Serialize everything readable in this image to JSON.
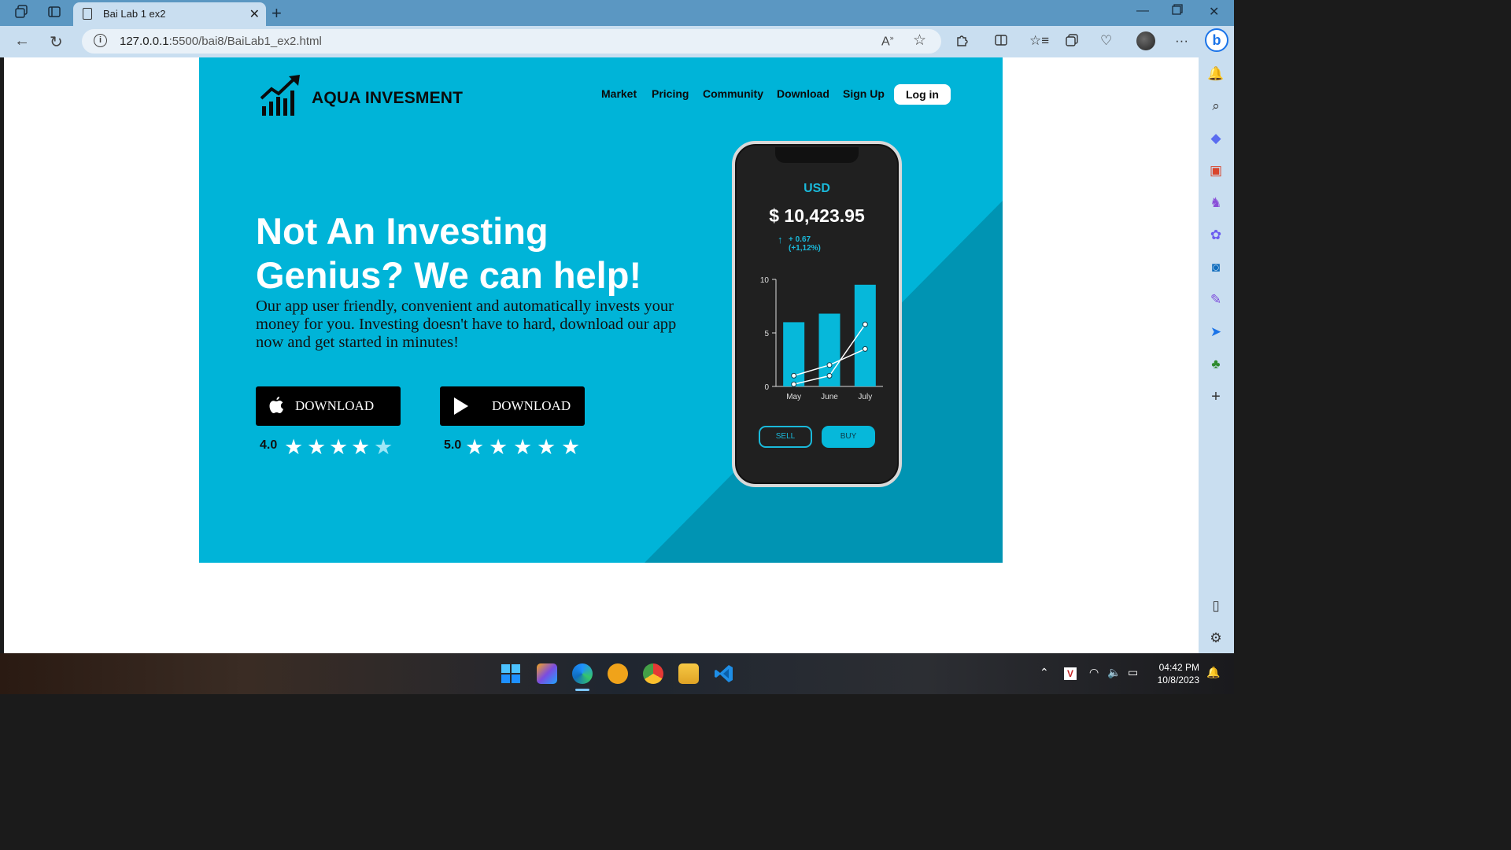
{
  "browser": {
    "tab_title": "Bai Lab 1 ex2",
    "url_host": "127.0.0.1",
    "url_path": ":5500/bai8/BaiLab1_ex2.html"
  },
  "site": {
    "brand": "AQUA INVESMENT",
    "nav": [
      "Market",
      "Pricing",
      "Community",
      "Download",
      "Sign Up"
    ],
    "login": "Log in",
    "headline_line1": "Not An Investing",
    "headline_line2": "Genius? We can help!",
    "description": "Our app user friendly, convenient and automatically invests your money for you. Investing doesn't have to hard, download our app now and get started in minutes!",
    "apple_button": "DOWNLOAD",
    "play_button": "DOWNLOAD",
    "apple_rating": "4.0",
    "play_rating": "5.0",
    "apple_stars": 4.5,
    "play_stars": 5
  },
  "phone": {
    "currency": "USD",
    "amount": "$ 10,423.95",
    "change_line1": "+ 0.67",
    "change_line2": "(+1,12%)",
    "sell": "SELL",
    "buy": "BUY"
  },
  "chart_data": {
    "type": "bar",
    "categories": [
      "May",
      "June",
      "July"
    ],
    "values": [
      6,
      6.8,
      9.5
    ],
    "series": [
      {
        "values": [
          1,
          2,
          3.5
        ]
      },
      {
        "values": [
          0.2,
          1,
          5.8
        ]
      }
    ],
    "ylim": [
      0,
      10
    ],
    "yticks": [
      "10",
      "5",
      "0"
    ]
  },
  "taskbar": {
    "time": "04:42 PM",
    "date": "10/8/2023"
  },
  "colors": {
    "hero": "#00b4d8",
    "accent": "#1ab9da",
    "dark": "#000000"
  }
}
